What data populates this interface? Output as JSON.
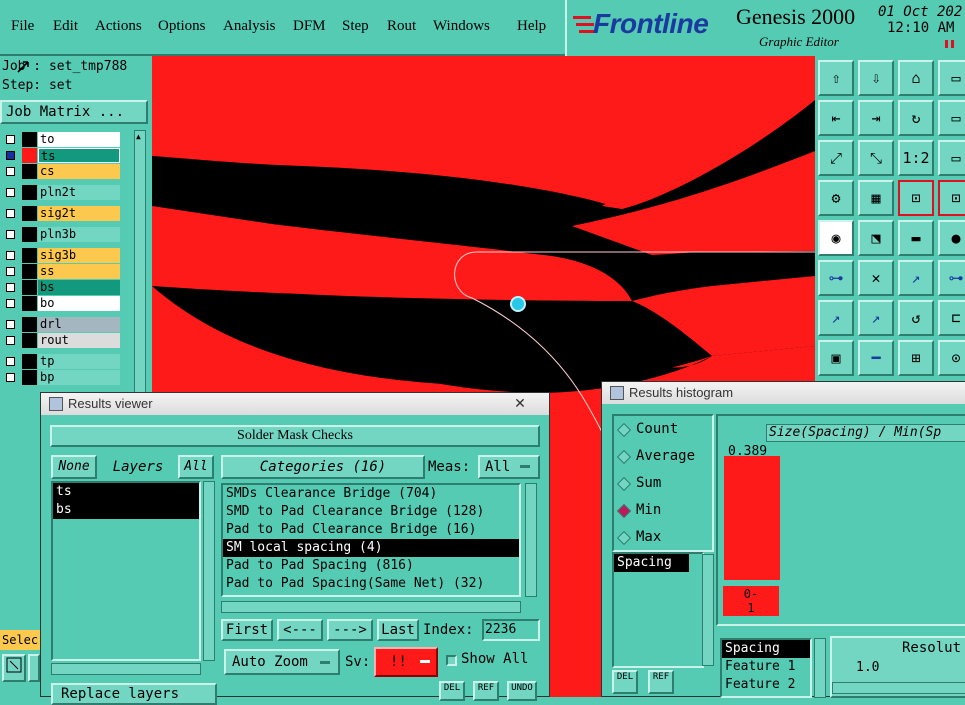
{
  "menubar": {
    "items": [
      "File",
      "Edit",
      "Actions",
      "Options",
      "Analysis",
      "DFM",
      "Step",
      "Rout",
      "Windows",
      "Help"
    ]
  },
  "brand": {
    "logo": "Frontline",
    "product": "Genesis 2000",
    "subtitle": "Graphic Editor",
    "date": "01 Oct 202",
    "time": "12:10 AM"
  },
  "job": {
    "job_text": "Job : set_tmp788",
    "step_text": "Step: set",
    "matrix_button": "Job Matrix ..."
  },
  "layers": [
    {
      "name": "to",
      "color": "#ffffff"
    },
    {
      "name": "ts",
      "color": "#139a7e"
    },
    {
      "name": "cs",
      "color": "#fcc94e"
    },
    {
      "name": "pln2t",
      "color": "#73d6c3"
    },
    {
      "name": "sig2t",
      "color": "#fcc94e"
    },
    {
      "name": "pln3b",
      "color": "#73d6c3"
    },
    {
      "name": "sig3b",
      "color": "#fcc94e"
    },
    {
      "name": "ss",
      "color": "#fcc94e"
    },
    {
      "name": "bs",
      "color": "#139a7e"
    },
    {
      "name": "bo",
      "color": "#ffffff"
    },
    {
      "name": "drl",
      "color": "#a4b6c0"
    },
    {
      "name": "rout",
      "color": "#dcdcdc"
    },
    {
      "name": "tp",
      "color": "#73d6c3"
    },
    {
      "name": "bp",
      "color": "#73d6c3"
    }
  ],
  "left_bottom": {
    "select_label": "Selec"
  },
  "tool_labels": {
    "ratio": "1:2"
  },
  "results_viewer": {
    "title": "Results viewer",
    "close": "✕",
    "header": "Solder Mask Checks",
    "none_label": "None",
    "layers_label": "Layers",
    "all_label": "All",
    "layer_items": [
      "ts",
      "bs"
    ],
    "categories_label": "Categories (16)",
    "meas_label": "Meas:",
    "meas_value": "All",
    "categories": [
      "SMDs Clearance Bridge (704)",
      "SMD to Pad Clearance Bridge (128)",
      "Pad to Pad Clearance Bridge (16)",
      "SM local spacing (4)",
      "Pad to Pad Spacing (816)",
      "Pad to Pad Spacing(Same Net) (32)"
    ],
    "selected_category": 3,
    "first_btn": "First",
    "prev_btn": "<---",
    "next_btn": "--->",
    "last_btn": "Last",
    "index_label": "Index:",
    "index_value": "2236",
    "zoom_btn": "Auto Zoom",
    "sv_label": "Sv:",
    "sv_value": "!!",
    "show_all": "Show All",
    "replace_btn": "Replace layers",
    "del_btn": "DEL",
    "ref_btn": "REF",
    "undo_btn": "UNDO"
  },
  "histogram": {
    "title": "Results histogram",
    "modes": [
      "Count",
      "Average",
      "Sum",
      "Min",
      "Max"
    ],
    "selected_mode": "Min",
    "axis_title": "Size(Spacing) / Min(Sp",
    "bar_value": "0.389",
    "bar_range_top": "0-",
    "bar_range_bottom": "1",
    "field_list": [
      "Spacing"
    ],
    "lower_list": [
      "Spacing",
      "Feature 1",
      "Feature 2"
    ],
    "resolution_label": "Resolut",
    "resolution_value": "1.0",
    "del_btn": "DEL",
    "ref_btn": "REF"
  },
  "chart_data": {
    "type": "bar",
    "categories": [
      "0-1"
    ],
    "values": [
      0.389
    ],
    "title": "Size(Spacing) / Min(Sp",
    "xlabel": "",
    "ylabel": ""
  },
  "colors": {
    "panel": "#55cbb3",
    "button": "#73d6c3",
    "canvas_red": "#ff1a1a",
    "canvas_black": "#000000",
    "selection": "#000000",
    "sv_red": "#ff1a1a"
  }
}
